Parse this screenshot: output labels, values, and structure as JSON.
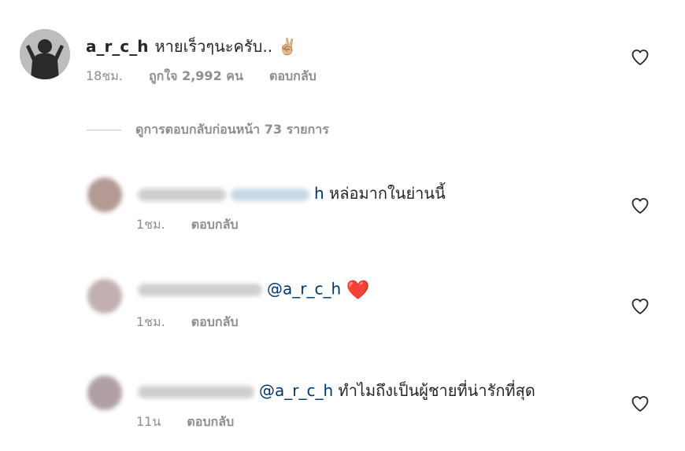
{
  "main_comment": {
    "username": "a_r_c_h",
    "text": "หายเร็วๆนะครับ..",
    "emoji": "✌🏼",
    "time": "18ชม.",
    "likes": "ถูกใจ 2,992 คน",
    "reply_label": "ตอบกลับ"
  },
  "view_replies": {
    "label": "ดูการตอบกลับก่อนหน้า 73 รายการ"
  },
  "replies": [
    {
      "mention": "h",
      "text": "หล่อมากในย่านนี้",
      "time": "1ชม.",
      "reply_label": "ตอบกลับ"
    },
    {
      "mention": "@a_r_c_h",
      "text": "",
      "emoji": "❤️",
      "time": "1ชม.",
      "reply_label": "ตอบกลับ"
    },
    {
      "mention": "@a_r_c_h",
      "text": "ทำไมถึงเป็นผู้ชายที่น่ารักที่สุด",
      "time": "11น",
      "reply_label": "ตอบกลับ"
    }
  ],
  "icons": {
    "like": "heart-outline-icon"
  }
}
